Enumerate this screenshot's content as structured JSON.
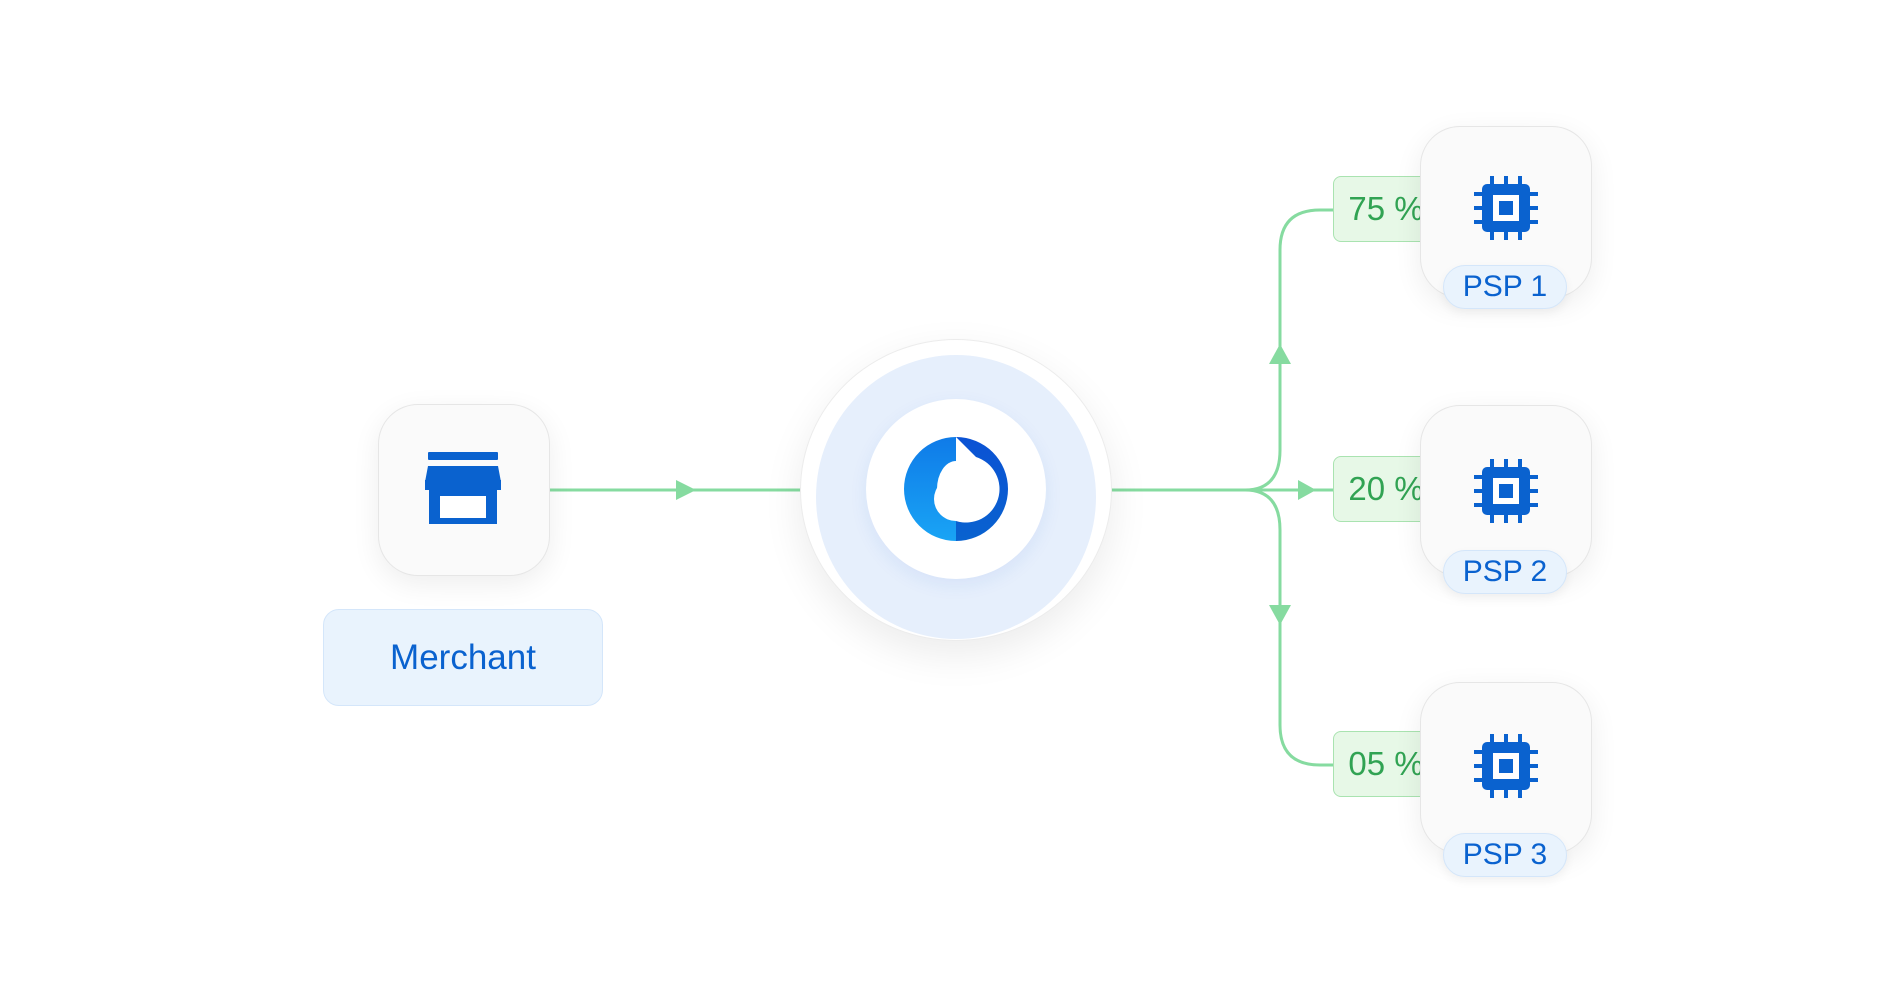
{
  "merchant": {
    "label": "Merchant",
    "icon": "storefront-icon"
  },
  "router": {
    "icon": "router-logo-icon"
  },
  "splits": [
    {
      "percent": "75 %",
      "psp": "PSP 1",
      "icon": "chip-icon"
    },
    {
      "percent": "20 %",
      "psp": "PSP 2",
      "icon": "chip-icon"
    },
    {
      "percent": "05 %",
      "psp": "PSP 3",
      "icon": "chip-icon"
    }
  ],
  "colors": {
    "connector": "#86dba0",
    "accent_blue": "#0a62cf",
    "percent_text": "#31a353",
    "label_bg": "#e9f3fd",
    "percent_bg": "#e7f8e7"
  }
}
